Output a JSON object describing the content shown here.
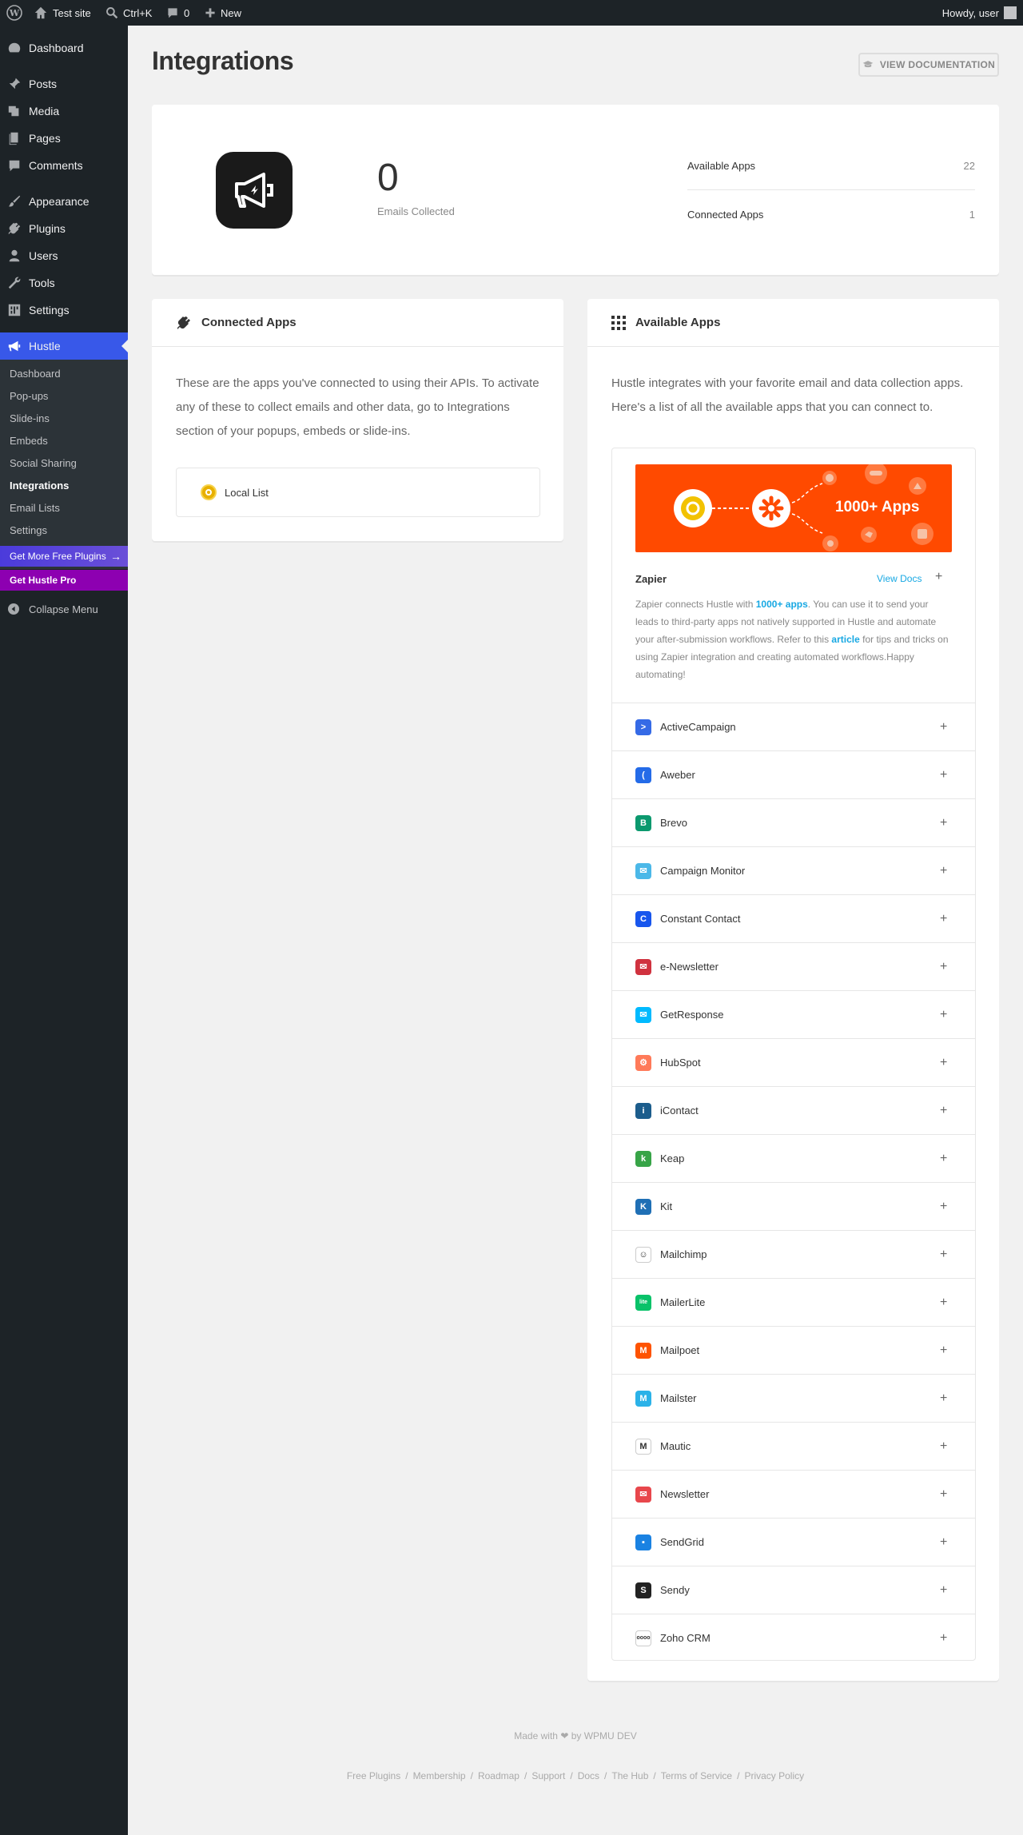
{
  "adminbar": {
    "site_name": "Test site",
    "search_shortcut": "Ctrl+K",
    "comments_count": "0",
    "new_label": "New",
    "howdy": "Howdy, user"
  },
  "sidebar": {
    "items": [
      {
        "label": "Dashboard",
        "icon": "dashboard-icon"
      },
      {
        "label": "Posts",
        "icon": "pin-icon"
      },
      {
        "label": "Media",
        "icon": "media-icon"
      },
      {
        "label": "Pages",
        "icon": "pages-icon"
      },
      {
        "label": "Comments",
        "icon": "comment-icon"
      },
      {
        "label": "Appearance",
        "icon": "brush-icon"
      },
      {
        "label": "Plugins",
        "icon": "plug-icon"
      },
      {
        "label": "Users",
        "icon": "user-icon"
      },
      {
        "label": "Tools",
        "icon": "wrench-icon"
      },
      {
        "label": "Settings",
        "icon": "settings-icon"
      },
      {
        "label": "Hustle",
        "icon": "megaphone-icon"
      }
    ],
    "submenu": [
      "Dashboard",
      "Pop-ups",
      "Slide-ins",
      "Embeds",
      "Social Sharing",
      "Integrations",
      "Email Lists",
      "Settings"
    ],
    "promo_free": "Get More Free Plugins",
    "promo_pro": "Get Hustle Pro",
    "collapse": "Collapse Menu"
  },
  "page": {
    "title": "Integrations",
    "doc_button": "VIEW DOCUMENTATION"
  },
  "summary": {
    "emails_count": "0",
    "emails_label": "Emails Collected",
    "available_label": "Available Apps",
    "available_value": "22",
    "connected_label": "Connected Apps",
    "connected_value": "1"
  },
  "connected": {
    "title": "Connected Apps",
    "description_lines": [
      "These are the apps you've connected to using their APIs. To activate",
      "any of these to collect emails and other data, go to Integrations",
      "section of your popups, embeds or slide-ins."
    ],
    "local_list": "Local List"
  },
  "available": {
    "title": "Available Apps",
    "description_lines": [
      "Hustle integrates with your favorite email and data collection apps.",
      "Here's a list of all the available apps that you can connect to."
    ],
    "zapier": {
      "banner_text": "1000+ Apps",
      "name": "Zapier",
      "docs": "View Docs",
      "desc_1": "Zapier connects Hustle with ",
      "desc_link1": "1000+ apps",
      "desc_2": ". You can use it to send your leads to third-party apps not natively supported in Hustle and automate your after-submission workflows. Refer to this ",
      "desc_link2": "article",
      "desc_3": " for tips and tricks on using Zapier integration and creating automated workflows.Happy automating!"
    },
    "apps": [
      {
        "name": "ActiveCampaign",
        "color": "#356ae6",
        "glyph": ">"
      },
      {
        "name": "Aweber",
        "color": "#246be8",
        "glyph": "("
      },
      {
        "name": "Brevo",
        "color": "#0b996e",
        "glyph": "B"
      },
      {
        "name": "Campaign Monitor",
        "color": "#4bb8e8",
        "glyph": "✉"
      },
      {
        "name": "Constant Contact",
        "color": "#1856ed",
        "glyph": "C"
      },
      {
        "name": "e-Newsletter",
        "color": "#d0323f",
        "glyph": "✉"
      },
      {
        "name": "GetResponse",
        "color": "#00baff",
        "glyph": "✉"
      },
      {
        "name": "HubSpot",
        "color": "#ff7a59",
        "glyph": "⚙"
      },
      {
        "name": "iContact",
        "color": "#1c5d8c",
        "glyph": "i"
      },
      {
        "name": "Keap",
        "color": "#37a447",
        "glyph": "k"
      },
      {
        "name": "Kit",
        "color": "#1f6fb5",
        "glyph": "K"
      },
      {
        "name": "Mailchimp",
        "color": "#ffffff",
        "glyph": "☺"
      },
      {
        "name": "MailerLite",
        "color": "#09c269",
        "glyph": "lite"
      },
      {
        "name": "Mailpoet",
        "color": "#fe5301",
        "glyph": "M"
      },
      {
        "name": "Mailster",
        "color": "#2bb2e8",
        "glyph": "M"
      },
      {
        "name": "Mautic",
        "color": "#ffffff",
        "glyph": "M"
      },
      {
        "name": "Newsletter",
        "color": "#e8474c",
        "glyph": "✉"
      },
      {
        "name": "SendGrid",
        "color": "#1a82e2",
        "glyph": "▪"
      },
      {
        "name": "Sendy",
        "color": "#222222",
        "glyph": "S"
      },
      {
        "name": "Zoho CRM",
        "color": "#ffffff",
        "glyph": "oooo"
      }
    ]
  },
  "footer": {
    "made_with": "Made with",
    "by": "by WPMU DEV",
    "links": [
      "Free Plugins",
      "Membership",
      "Roadmap",
      "Support",
      "Docs",
      "The Hub",
      "Terms of Service",
      "Privacy Policy"
    ]
  }
}
